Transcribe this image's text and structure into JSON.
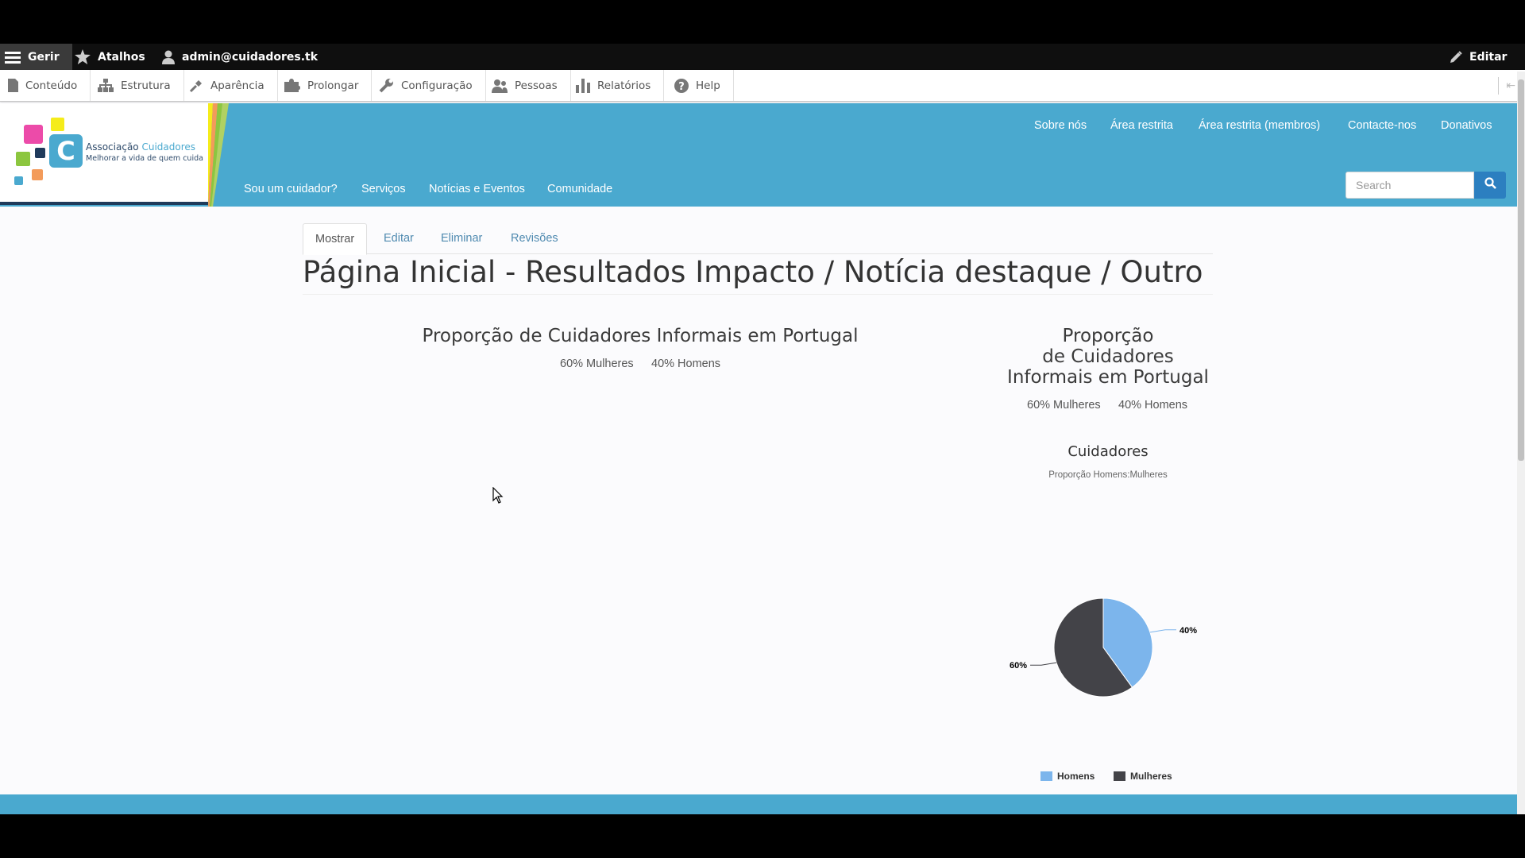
{
  "admin_bar": {
    "manage": "Gerir",
    "shortcuts": "Atalhos",
    "user": "admin@cuidadores.tk",
    "edit": "Editar"
  },
  "admin_tray": {
    "items": [
      "Conteúdo",
      "Estrutura",
      "Aparência",
      "Prolongar",
      "Configuração",
      "Pessoas",
      "Relatórios",
      "Help"
    ]
  },
  "site": {
    "logo_name_prefix": "Associação",
    "logo_name_accent": "Cuidadores",
    "logo_letter": "C",
    "logo_slogan": "Melhorar a vida de quem cuida",
    "top_nav": [
      "Sobre nós",
      "Área restrita",
      "Área restrita (membros)",
      "Contacte-nos",
      "Donativos"
    ],
    "main_nav": [
      "Sou um cuidador?",
      "Serviços",
      "Notícias e Eventos",
      "Comunidade"
    ],
    "search_placeholder": "Search"
  },
  "tabs": [
    "Mostrar",
    "Editar",
    "Eliminar",
    "Revisões"
  ],
  "page_title": "Página Inicial - Resultados Impacto / Notícia destaque / Outro",
  "left_block": {
    "title": "Proporção de Cuidadores Informais em Portugal",
    "women": "60% Mulheres",
    "men": "40% Homens"
  },
  "right_block": {
    "title_lines": [
      "Proporção",
      "de Cuidadores",
      "Informais em Portugal"
    ],
    "women": "60% Mulheres",
    "men": "40% Homens"
  },
  "colors": {
    "header": "#4aa9cf",
    "homens": "#7cb5ec",
    "mulheres": "#434348"
  },
  "chart_data": {
    "type": "pie",
    "title": "Cuidadores",
    "subtitle": "Proporção Homens:Mulheres",
    "series": [
      {
        "name": "Homens",
        "value": 40,
        "label": "40%",
        "color": "#7cb5ec"
      },
      {
        "name": "Mulheres",
        "value": 60,
        "label": "60%",
        "color": "#434348"
      }
    ],
    "legend": "bottom"
  }
}
